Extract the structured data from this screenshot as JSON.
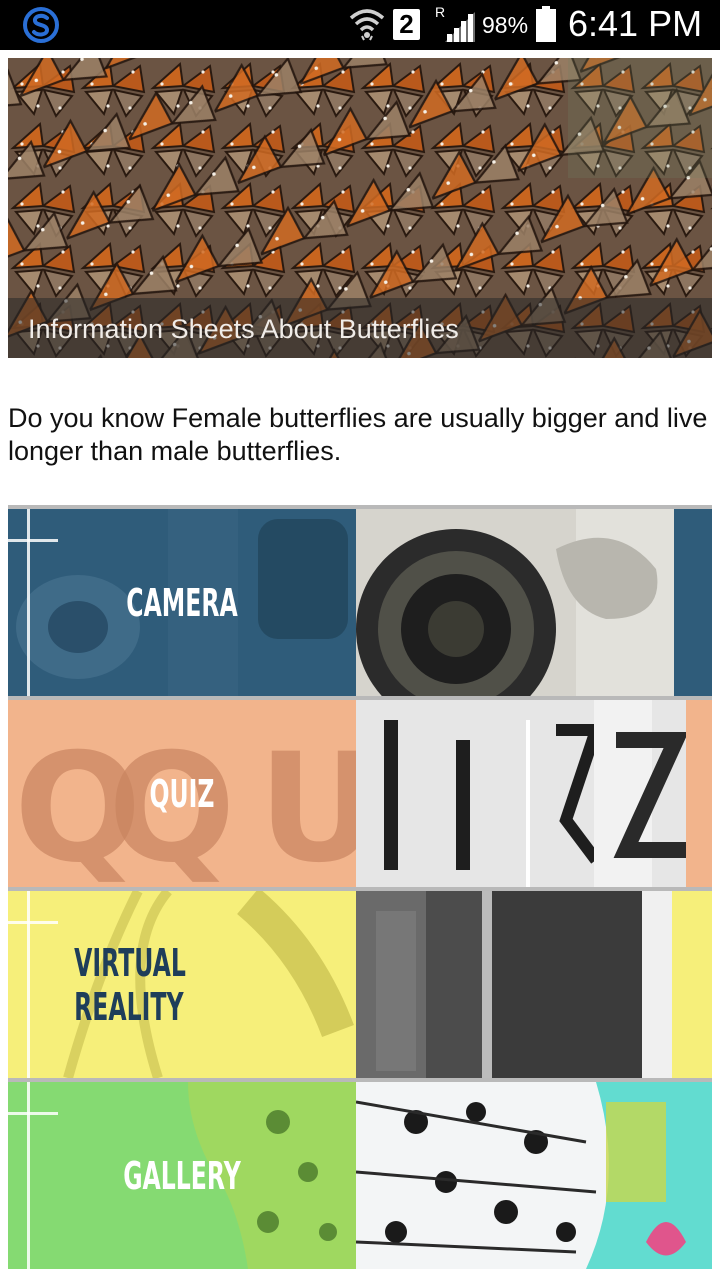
{
  "status_bar": {
    "sim_slot": "2",
    "roaming": "R",
    "battery": "98%",
    "time": "6:41 PM",
    "icons": [
      "app-s-icon",
      "wifi-icon",
      "signal-icon",
      "battery-icon"
    ]
  },
  "hero": {
    "caption": "Information Sheets About Butterflies",
    "image": "monarch-butterflies-cluster"
  },
  "fact": {
    "text": "Do you know Female butterflies are usually bigger and live longer than male butterflies."
  },
  "menu": {
    "items": [
      {
        "label": "CAMERA",
        "color": "#2c5a78",
        "text_color": "#ffffff"
      },
      {
        "label": "QUIZ",
        "color": "#f2b48c",
        "text_color": "#ffffff"
      },
      {
        "label": "VIRTUAL REALITY",
        "color": "#f7ef7a",
        "text_color": "#1f3e5a"
      },
      {
        "label": "GALLERY",
        "color": "#7ed66f",
        "text_color": "#ffffff"
      }
    ]
  }
}
